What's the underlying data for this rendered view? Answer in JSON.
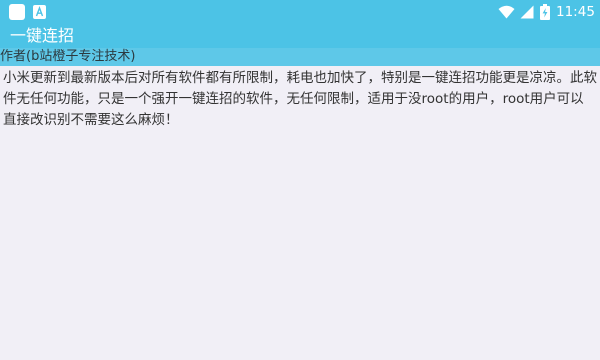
{
  "status_bar": {
    "time": "11:45",
    "notification_icons": [
      "app-notification-icon",
      "a-notification-icon"
    ],
    "system_icons": [
      "wifi-icon",
      "signal-icon",
      "battery-charging-icon"
    ],
    "colors": {
      "background": "#4cc3e6",
      "foreground": "#ffffff"
    }
  },
  "app_bar": {
    "title": "一键连招",
    "colors": {
      "background": "#4cc3e6",
      "foreground": "#ffffff"
    }
  },
  "author_bar": {
    "text": "作者(b站橙子专注技术)",
    "colors": {
      "background": "#5ec8e8",
      "foreground": "#2c3a40"
    }
  },
  "content": {
    "description": "小米更新到最新版本后对所有软件都有所限制，耗电也加快了，特别是一键连招功能更是凉凉。此软件无任何功能，只是一个强开一键连招的软件，无任何限制，适用于没root的用户，root用户可以直接改识别不需要这么麻烦！",
    "colors": {
      "background": "#f1eff6",
      "text": "#333333"
    }
  }
}
